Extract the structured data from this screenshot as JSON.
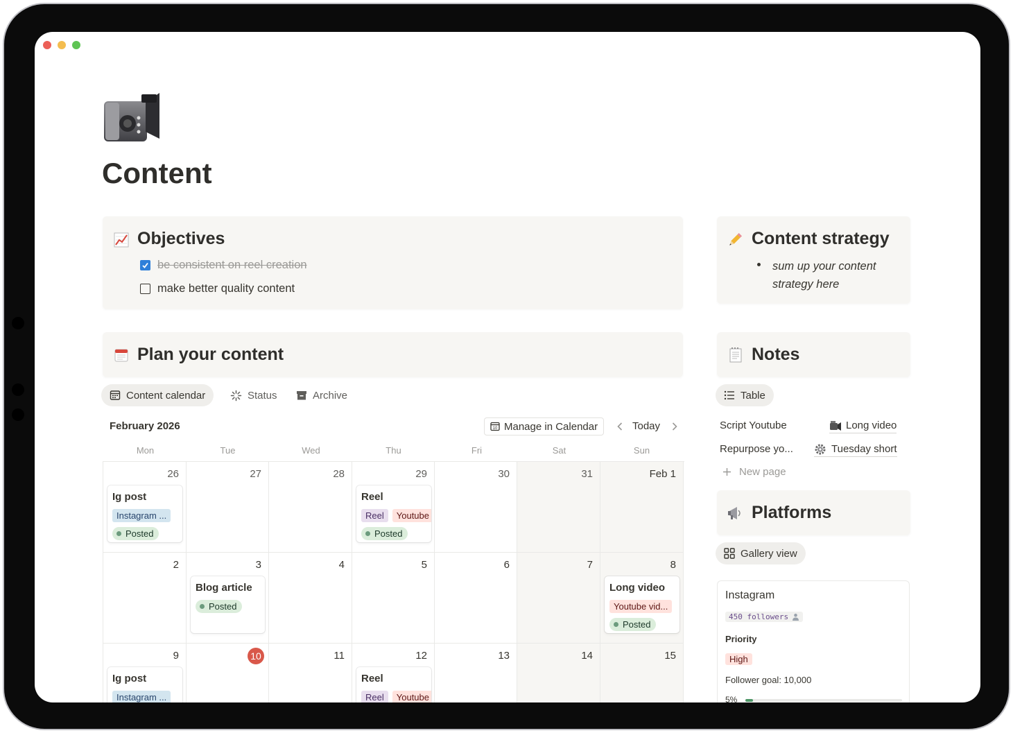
{
  "page": {
    "icon": "video-camera-icon",
    "title": "Content"
  },
  "objectives": {
    "icon": "chart-increasing-icon",
    "heading": "Objectives",
    "todos": [
      {
        "text": "be consistent on reel creation",
        "checked": true
      },
      {
        "text": "make better quality content",
        "checked": false
      }
    ]
  },
  "strategy": {
    "icon": "pencil-icon",
    "heading": "Content strategy",
    "bullet": "sum up your content strategy here"
  },
  "plan": {
    "icon": "calendar-icon",
    "heading": "Plan your content",
    "tabs": [
      {
        "label": "Content calendar",
        "icon": "calendar-view-icon",
        "active": true
      },
      {
        "label": "Status",
        "icon": "loading-icon",
        "active": false
      },
      {
        "label": "Archive",
        "icon": "archive-icon",
        "active": false
      }
    ]
  },
  "calendar": {
    "month": "February 2026",
    "manage_label": "Manage in Calendar",
    "today_label": "Today",
    "weekdays": [
      "Mon",
      "Tue",
      "Wed",
      "Thu",
      "Fri",
      "Sat",
      "Sun"
    ],
    "weeks": [
      [
        "26",
        "27",
        "28",
        "29",
        "30",
        "31",
        "Feb 1"
      ],
      [
        "2",
        "3",
        "4",
        "5",
        "6",
        "7",
        "8"
      ],
      [
        "9",
        "10",
        "11",
        "12",
        "13",
        "14",
        "15"
      ]
    ],
    "today": "10",
    "events": {
      "ig_post_1": {
        "title": "Ig post",
        "tag": "Instagram ...",
        "status": "Posted"
      },
      "reel_1": {
        "title": "Reel",
        "tag1": "Reel",
        "tag2": "Youtube",
        "status": "Posted"
      },
      "blog": {
        "title": "Blog article",
        "status": "Posted"
      },
      "long_video": {
        "title": "Long video",
        "tag": "Youtube vid...",
        "status": "Posted"
      },
      "ig_post_2": {
        "title": "Ig post",
        "tag": "Instagram ..."
      },
      "reel_2": {
        "title": "Reel",
        "tag1": "Reel",
        "tag2": "Youtube"
      }
    }
  },
  "notes": {
    "icon": "notepad-icon",
    "heading": "Notes",
    "view_label": "Table",
    "rows": [
      {
        "name": "Script Youtube",
        "prop": "Long video",
        "prop_icon": "video-camera-icon"
      },
      {
        "name": "Repurpose yo...",
        "prop": "Tuesday short",
        "prop_icon": "gear-icon"
      }
    ],
    "new_page": "New page"
  },
  "platforms": {
    "icon": "megaphone-icon",
    "heading": "Platforms",
    "view_label": "Gallery view",
    "card": {
      "title": "Instagram",
      "followers": "450 followers",
      "priority_label": "Priority",
      "priority": "High",
      "goal": "Follower goal: 10,000",
      "progress_text": "5%",
      "progress": 0.05
    }
  },
  "colors": {
    "accent": "#2e7fd9",
    "today": "#d9584a",
    "callout_bg": "#f7f6f3"
  }
}
